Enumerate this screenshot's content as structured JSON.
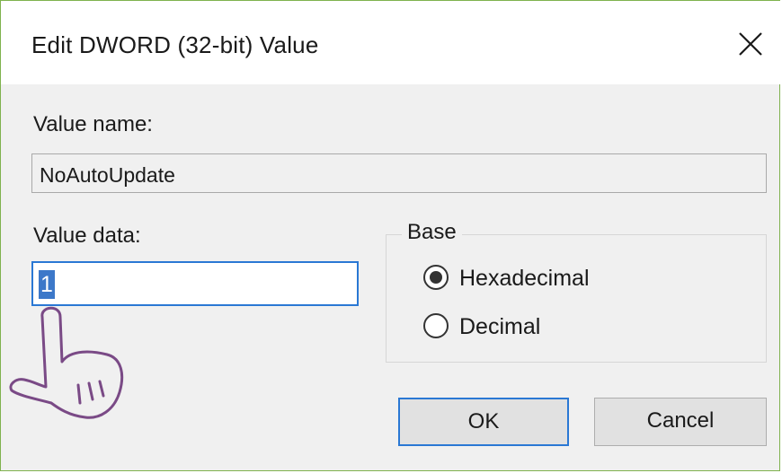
{
  "dialog": {
    "title": "Edit DWORD (32-bit) Value",
    "close_icon": "close-icon"
  },
  "value_name": {
    "label": "Value name:",
    "value": "NoAutoUpdate"
  },
  "value_data": {
    "label": "Value data:",
    "value": "1"
  },
  "base": {
    "legend": "Base",
    "options": [
      {
        "label": "Hexadecimal",
        "selected": true
      },
      {
        "label": "Decimal",
        "selected": false
      }
    ]
  },
  "buttons": {
    "ok": "OK",
    "cancel": "Cancel"
  },
  "annotation": {
    "icon": "pointing-hand-icon",
    "color": "#7a4a86"
  },
  "colors": {
    "accent": "#2a78d4",
    "selection": "#3c78c9",
    "window_border": "#7fb24e"
  }
}
